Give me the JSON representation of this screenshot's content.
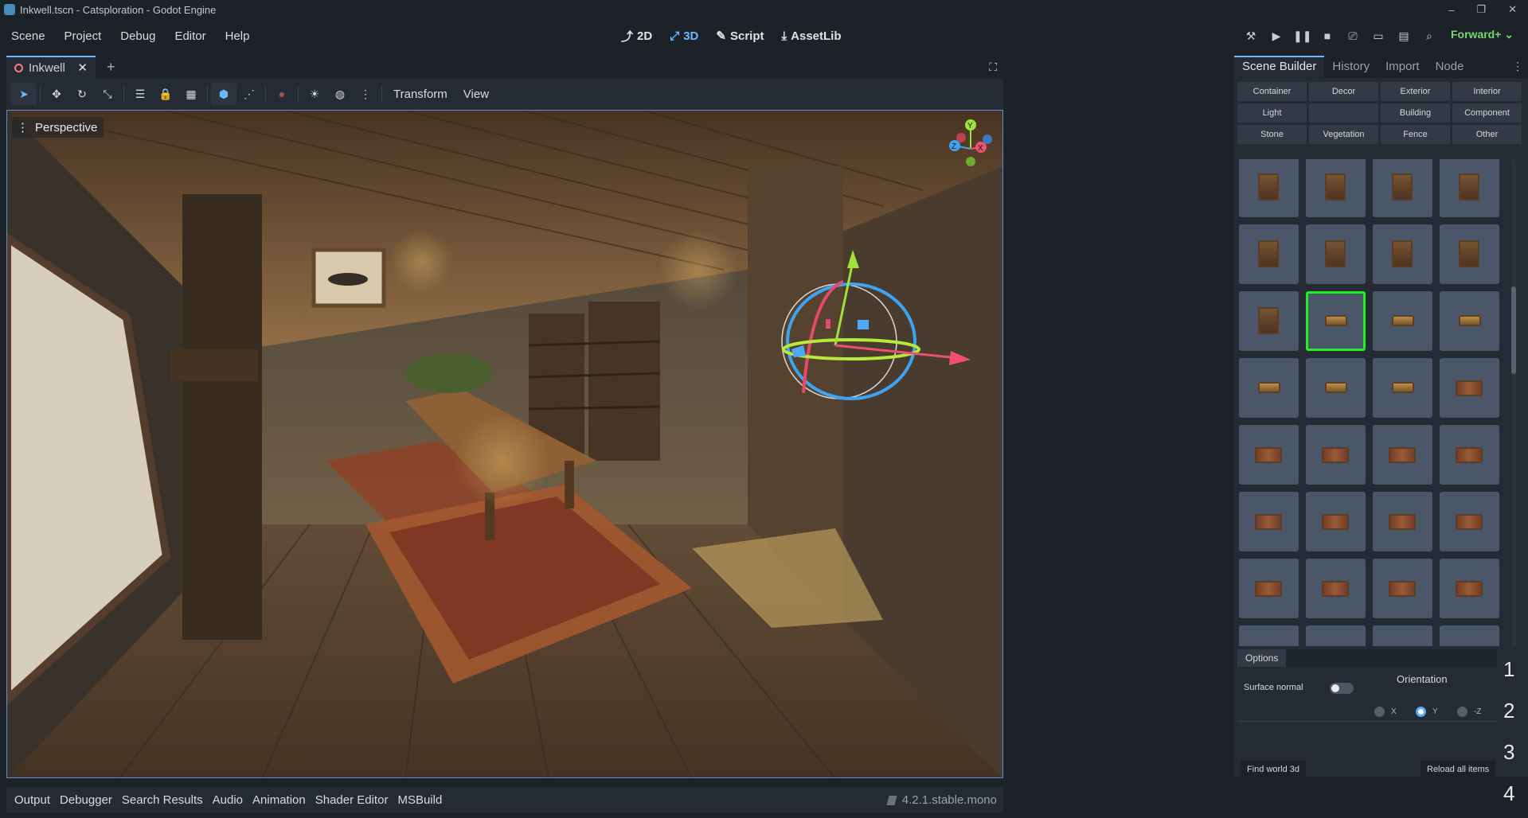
{
  "window": {
    "title": "Inkwell.tscn - Catsploration - Godot Engine",
    "controls": [
      "–",
      "❐",
      "✕"
    ]
  },
  "menu": [
    "Scene",
    "Project",
    "Debug",
    "Editor",
    "Help"
  ],
  "modes": [
    {
      "label": "2D",
      "icon": "⤴"
    },
    {
      "label": "3D",
      "icon": "⤢"
    },
    {
      "label": "Script",
      "icon": "✎"
    },
    {
      "label": "AssetLib",
      "icon": "⤓"
    }
  ],
  "run_icons": [
    "⚒",
    "▶",
    "❚❚",
    "■",
    "⎚",
    "▭",
    "▤",
    "⌕"
  ],
  "renderer": "Forward+",
  "editor": {
    "tab": "Inkwell",
    "add_tab": "+",
    "toolbar_menus": [
      "Transform",
      "View"
    ],
    "viewport_label": "Perspective"
  },
  "gizmo": {
    "x": "X",
    "y": "Y",
    "z": "Z"
  },
  "dock": {
    "tabs": [
      "Scene Builder",
      "History",
      "Import",
      "Node"
    ],
    "categories": [
      "Container",
      "Decor",
      "Exterior",
      "Interior",
      "Light",
      "",
      "Building",
      "Component",
      "Stone",
      "Vegetation",
      "Fence",
      "Other"
    ],
    "options_tab": "Options",
    "surface_normal": "Surface normal",
    "orientation": "Orientation",
    "axes": [
      "X",
      "Y",
      "-Z"
    ],
    "selected_axis": "Y",
    "find_button": "Find world 3d",
    "reload_button": "Reload all items",
    "numbers": [
      "1",
      "2",
      "3",
      "4"
    ]
  },
  "bottom": {
    "tabs": [
      "Output",
      "Debugger",
      "Search Results",
      "Audio",
      "Animation",
      "Shader Editor",
      "MSBuild"
    ],
    "version": "4.2.1.stable.mono"
  }
}
